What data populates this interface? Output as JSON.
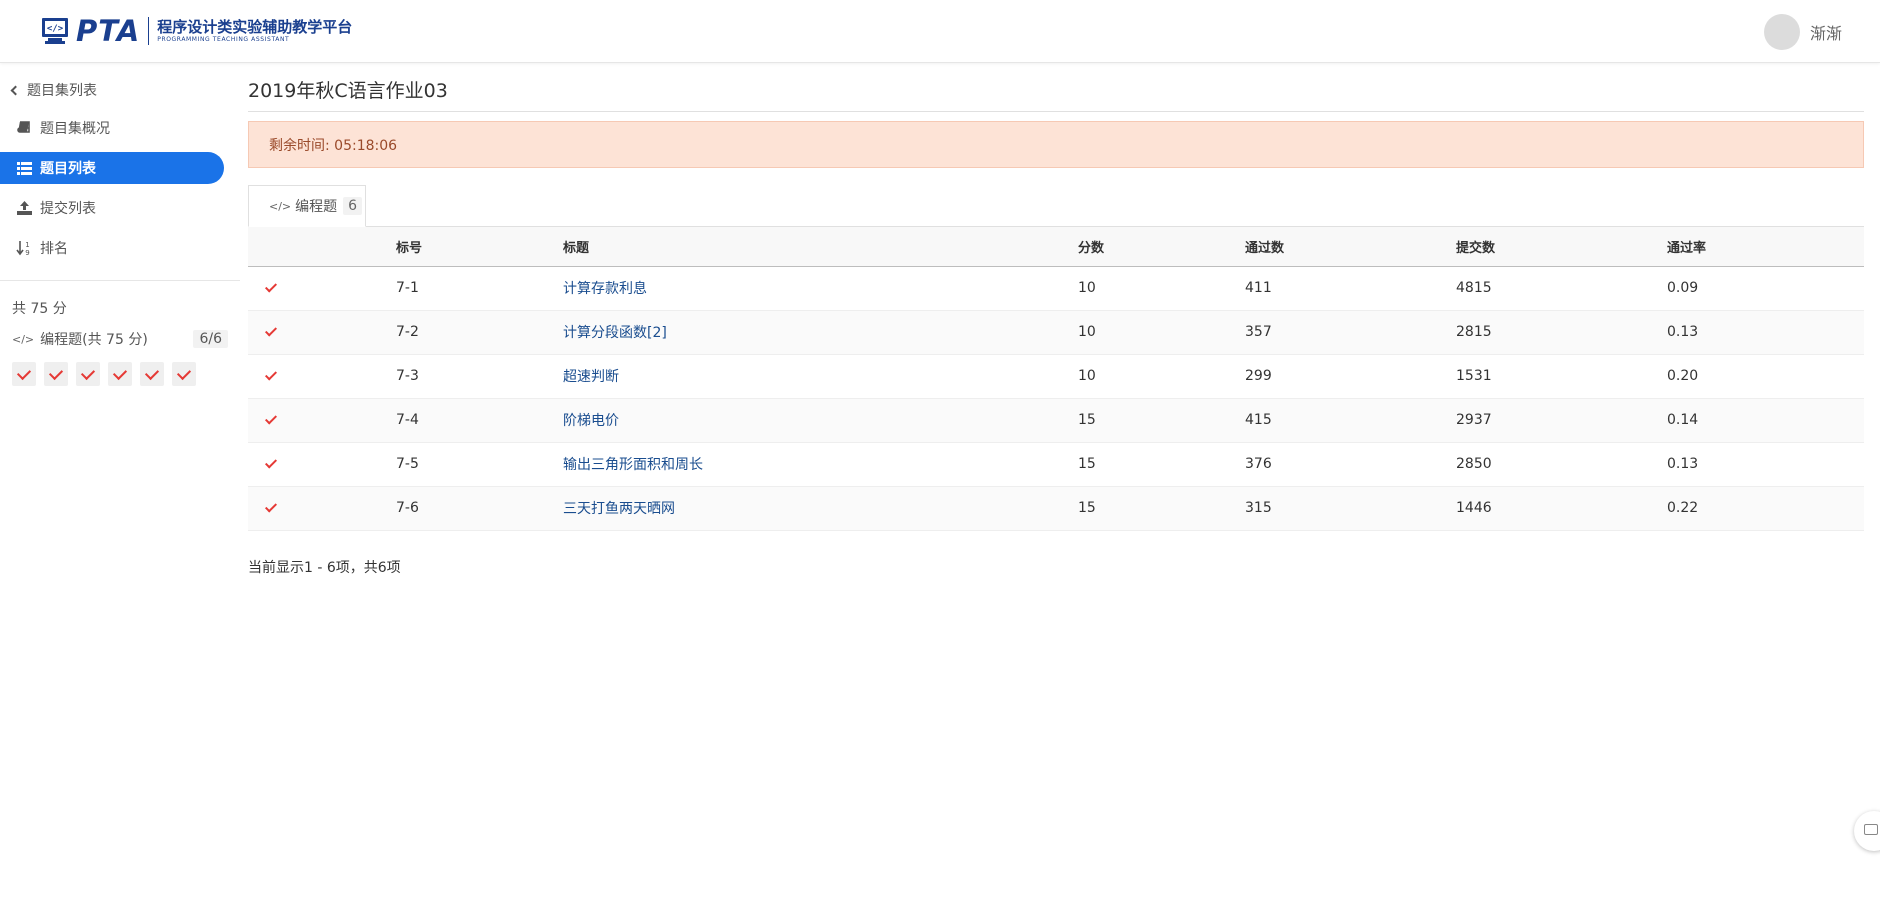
{
  "header": {
    "logo_text": "PTA",
    "logo_cn": "程序设计类实验辅助教学平台",
    "logo_en": "PROGRAMMING TEACHING ASSISTANT",
    "username": "渐渐"
  },
  "sidebar": {
    "back_label": "题目集列表",
    "items": [
      {
        "label": "题目集概况",
        "icon": "book-icon"
      },
      {
        "label": "题目列表",
        "icon": "list-icon",
        "active": true
      },
      {
        "label": "提交列表",
        "icon": "upload-icon"
      },
      {
        "label": "排名",
        "icon": "sort-icon"
      }
    ],
    "total": "共 75 分",
    "category": {
      "label": "编程题(共 75 分)",
      "count": "6/6"
    }
  },
  "main": {
    "title": "2019年秋C语言作业03",
    "alert": "剩余时间: 05:18:06",
    "tab": {
      "label": "编程题",
      "count": "6"
    },
    "table": {
      "headers": [
        "",
        "标号",
        "标题",
        "分数",
        "通过数",
        "提交数",
        "通过率"
      ],
      "rows": [
        {
          "id": "7-1",
          "title": "计算存款利息",
          "score": "10",
          "passed": "411",
          "submitted": "4815",
          "rate": "0.09"
        },
        {
          "id": "7-2",
          "title": "计算分段函数[2]",
          "score": "10",
          "passed": "357",
          "submitted": "2815",
          "rate": "0.13"
        },
        {
          "id": "7-3",
          "title": "超速判断",
          "score": "10",
          "passed": "299",
          "submitted": "1531",
          "rate": "0.20"
        },
        {
          "id": "7-4",
          "title": "阶梯电价",
          "score": "15",
          "passed": "415",
          "submitted": "2937",
          "rate": "0.14"
        },
        {
          "id": "7-5",
          "title": "输出三角形面积和周长",
          "score": "15",
          "passed": "376",
          "submitted": "2850",
          "rate": "0.13"
        },
        {
          "id": "7-6",
          "title": "三天打鱼两天晒网",
          "score": "15",
          "passed": "315",
          "submitted": "1446",
          "rate": "0.22"
        }
      ]
    },
    "footer": "当前显示1 - 6项，共6项"
  },
  "colors": {
    "accent": "#1a73e8",
    "brand": "#1a3f8f",
    "check": "#e53935",
    "alert_bg": "#fde3d6"
  }
}
